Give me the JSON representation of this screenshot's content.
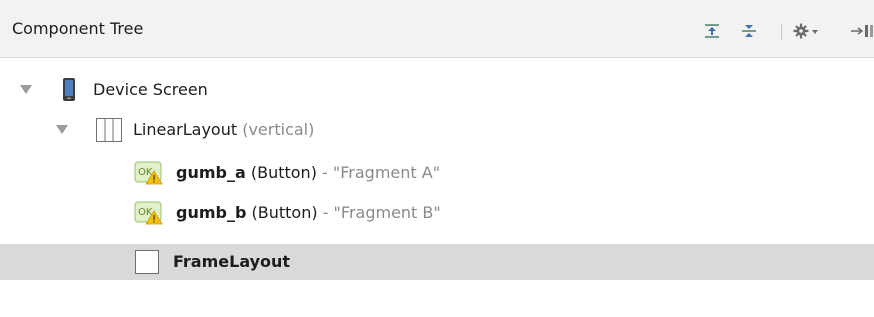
{
  "panel": {
    "title": "Component Tree",
    "toolbar": [
      {
        "icon": "expand-all-icon"
      },
      {
        "icon": "collapse-all-icon"
      },
      {
        "icon": "gear-icon"
      },
      {
        "icon": "hide-panel-icon"
      }
    ]
  },
  "tree": [
    {
      "name": "Device Screen",
      "icon": "device-phone-icon",
      "expanded": true
    },
    {
      "name": "LinearLayout",
      "detail": "(vertical)",
      "icon": "linear-layout-icon",
      "expanded": true
    },
    {
      "name": "gumb_a",
      "type": "(Button)",
      "text": "- \"Fragment A\"",
      "icon": "button-warning-icon"
    },
    {
      "name": "gumb_b",
      "type": "(Button)",
      "text": "- \"Fragment B\"",
      "icon": "button-warning-icon"
    },
    {
      "name": "FrameLayout",
      "icon": "frame-layout-icon",
      "selected": true
    }
  ],
  "colors": {
    "header_bg": "#f2f2f2",
    "selected_row": "#d9d9d9",
    "muted_text": "#8a8a8a",
    "phone_blue": "#3f6fb0"
  }
}
